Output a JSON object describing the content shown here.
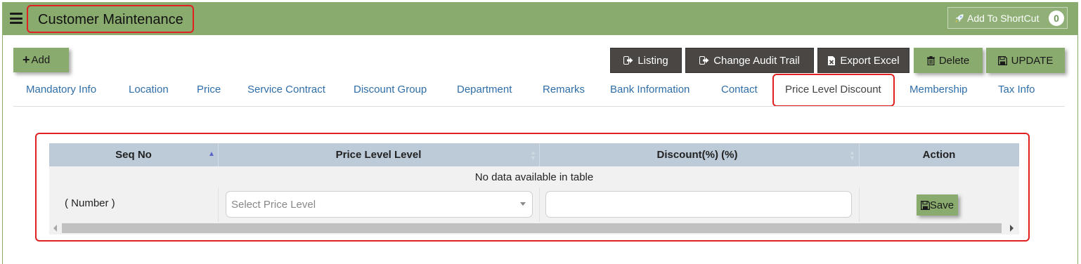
{
  "header": {
    "title": "Customer Maintenance",
    "shortcut_label": "Add To ShortCut",
    "shortcut_count": "0"
  },
  "toolbar": {
    "add_label": "Add",
    "listing_label": "Listing",
    "audit_label": "Change Audit Trail",
    "excel_label": "Export Excel",
    "delete_label": "Delete",
    "update_label": "UPDATE"
  },
  "tabs": [
    {
      "label": "Mandatory Info"
    },
    {
      "label": "Location"
    },
    {
      "label": "Price"
    },
    {
      "label": "Service Contract"
    },
    {
      "label": "Discount Group"
    },
    {
      "label": "Department"
    },
    {
      "label": "Remarks"
    },
    {
      "label": "Bank Information"
    },
    {
      "label": "Contact"
    },
    {
      "label": "Price Level Discount",
      "active": true
    },
    {
      "label": "Membership"
    },
    {
      "label": "Tax Info"
    }
  ],
  "table": {
    "columns": [
      "Seq No",
      "Price Level Level",
      "Discount(%) (%)",
      "Action"
    ],
    "empty_text": "No data available in table",
    "new_row": {
      "seq_placeholder": "( Number )",
      "price_level_placeholder": "Select Price Level",
      "discount_value": "",
      "save_label": "Save"
    }
  },
  "colors": {
    "header_green": "#8aab6e",
    "dark_button": "#4a4643",
    "tab_link": "#2f6ea8",
    "highlight_red": "#e02020",
    "table_header": "#bdcbd8"
  },
  "icons": {
    "menu": "hamburger-icon",
    "shortcut": "rocket-icon",
    "add": "plus-icon",
    "listing": "sign-out-icon",
    "audit": "sign-out-icon",
    "excel": "file-excel-icon",
    "delete": "trash-icon",
    "update": "floppy-disk-icon",
    "save": "floppy-disk-icon"
  }
}
